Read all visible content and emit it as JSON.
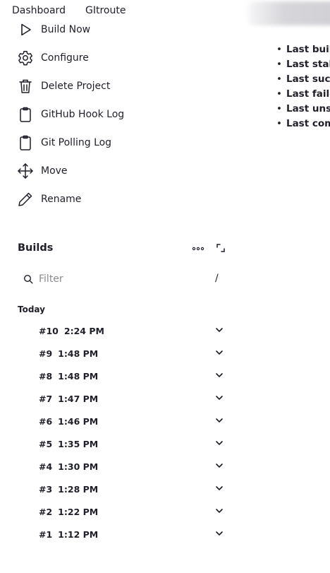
{
  "breadcrumbs": [
    "Dashboard",
    "GItroute"
  ],
  "tasks": [
    {
      "label": "Build Now",
      "icon": "play-icon"
    },
    {
      "label": "Configure",
      "icon": "gear-icon"
    },
    {
      "label": "Delete Project",
      "icon": "trash-icon"
    },
    {
      "label": "GitHub Hook Log",
      "icon": "clipboard-icon"
    },
    {
      "label": "Git Polling Log",
      "icon": "clipboard-icon"
    },
    {
      "label": "Move",
      "icon": "move-icon"
    },
    {
      "label": "Rename",
      "icon": "pencil-icon"
    }
  ],
  "permalinks": [
    "Last build",
    "Last stabl",
    "Last succe",
    "Last failed",
    "Last unsuc",
    "Last comp"
  ],
  "builds": {
    "title": "Builds",
    "filter_placeholder": "Filter",
    "filter_shortcut": "/",
    "group_label": "Today",
    "items": [
      {
        "number": "#10",
        "time": "2:24 PM"
      },
      {
        "number": "#9",
        "time": "1:48 PM"
      },
      {
        "number": "#8",
        "time": "1:48 PM"
      },
      {
        "number": "#7",
        "time": "1:47 PM"
      },
      {
        "number": "#6",
        "time": "1:46 PM"
      },
      {
        "number": "#5",
        "time": "1:35 PM"
      },
      {
        "number": "#4",
        "time": "1:30 PM"
      },
      {
        "number": "#3",
        "time": "1:28 PM"
      },
      {
        "number": "#2",
        "time": "1:22 PM"
      },
      {
        "number": "#1",
        "time": "1:12 PM"
      }
    ]
  }
}
